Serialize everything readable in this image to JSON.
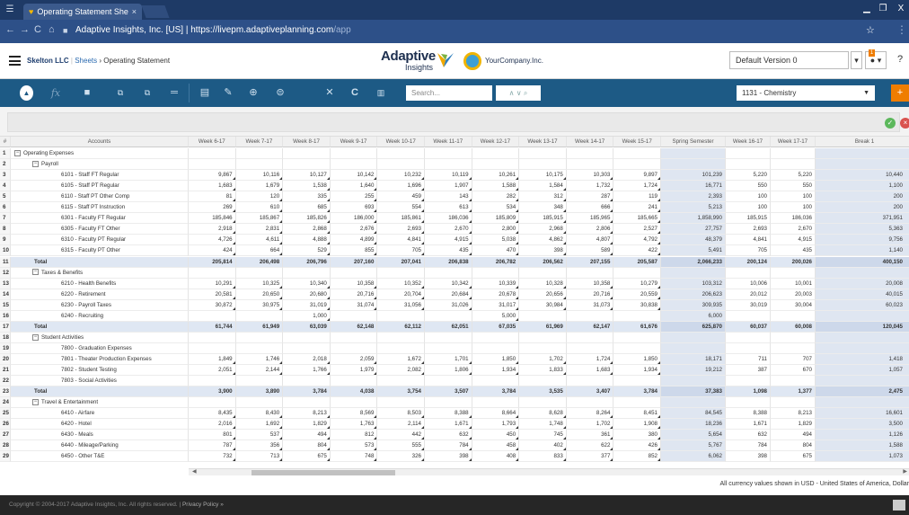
{
  "browser": {
    "tab_title": "Operating Statement She",
    "tab_close": "×",
    "url_host": "Adaptive Insights, Inc. [US]",
    "url_sep": "|",
    "url_main": "https://livepm.adaptiveplanning.com",
    "url_path": "/app",
    "star": "☆",
    "minimize": "▁",
    "maximize": "❐",
    "close": "X"
  },
  "app": {
    "org": "Skelton LLC",
    "sheets": "Sheets",
    "crumb_sep": "›",
    "page": "Operating Statement",
    "brand_top": "Adaptive",
    "brand_bottom": "Insights",
    "company": "YourCompany.Inc.",
    "version": "Default Version 0",
    "notif_count": "1",
    "help": "?"
  },
  "toolbar": {
    "fx": "fx",
    "search_placeholder": "Search...",
    "level": "1131 - Chemistry"
  },
  "grid": {
    "col_hash": "#",
    "col_accounts": "Accounts",
    "week_cols": [
      "Week 6-17",
      "Week 7-17",
      "Week 8-17",
      "Week 9-17",
      "Week 10-17",
      "Week 11-17",
      "Week 12-17",
      "Week 13-17",
      "Week 14-17",
      "Week 15-17"
    ],
    "col_spring": "Spring Semester",
    "col_w16": "Week 16-17",
    "col_w17": "Week 17-17",
    "col_break": "Break 1",
    "rows": [
      {
        "n": "1",
        "label": "Operating Expenses",
        "level": 0,
        "exp": "−",
        "type": "group",
        "v": [
          "",
          "",
          "",
          "",
          "",
          "",
          "",
          "",
          "",
          "",
          "",
          "",
          "",
          ""
        ]
      },
      {
        "n": "2",
        "label": "Payroll",
        "level": 1,
        "exp": "−",
        "type": "group",
        "v": [
          "",
          "",
          "",
          "",
          "",
          "",
          "",
          "",
          "",
          "",
          "",
          "",
          "",
          ""
        ]
      },
      {
        "n": "3",
        "label": "6101 - Staff FT Regular",
        "level": 2,
        "type": "item",
        "v": [
          "9,867",
          "10,116",
          "10,127",
          "10,142",
          "10,232",
          "10,119",
          "10,261",
          "10,175",
          "10,303",
          "9,897",
          "101,239",
          "5,220",
          "5,220",
          "10,440"
        ]
      },
      {
        "n": "4",
        "label": "6105 - Staff PT Regular",
        "level": 2,
        "type": "item",
        "v": [
          "1,683",
          "1,679",
          "1,538",
          "1,640",
          "1,696",
          "1,907",
          "1,588",
          "1,584",
          "1,732",
          "1,724",
          "16,771",
          "550",
          "550",
          "1,100"
        ]
      },
      {
        "n": "5",
        "label": "6110 - Staff PT Other Comp",
        "level": 2,
        "type": "item",
        "v": [
          "81",
          "120",
          "335",
          "255",
          "459",
          "143",
          "282",
          "312",
          "287",
          "119",
          "2,393",
          "100",
          "100",
          "200"
        ]
      },
      {
        "n": "6",
        "label": "6115 - Staff PT Instruction",
        "level": 2,
        "type": "item",
        "v": [
          "269",
          "610",
          "685",
          "693",
          "554",
          "613",
          "534",
          "348",
          "666",
          "241",
          "5,213",
          "100",
          "100",
          "200"
        ]
      },
      {
        "n": "7",
        "label": "6301 - Faculty FT Regular",
        "level": 2,
        "type": "item",
        "v": [
          "185,846",
          "185,867",
          "185,826",
          "186,000",
          "185,861",
          "186,036",
          "185,809",
          "185,915",
          "185,965",
          "185,665",
          "1,858,990",
          "185,915",
          "186,036",
          "371,951"
        ]
      },
      {
        "n": "8",
        "label": "6305 - Faculty FT Other",
        "level": 2,
        "type": "item",
        "v": [
          "2,918",
          "2,831",
          "2,868",
          "2,676",
          "2,693",
          "2,670",
          "2,800",
          "2,968",
          "2,806",
          "2,527",
          "27,757",
          "2,693",
          "2,670",
          "5,363"
        ]
      },
      {
        "n": "9",
        "label": "6310 - Faculty PT Regular",
        "level": 2,
        "type": "item",
        "v": [
          "4,726",
          "4,611",
          "4,888",
          "4,899",
          "4,841",
          "4,915",
          "5,038",
          "4,862",
          "4,807",
          "4,792",
          "48,379",
          "4,841",
          "4,915",
          "9,756"
        ]
      },
      {
        "n": "10",
        "label": "6315 - Faculty PT Other",
        "level": 2,
        "type": "item",
        "v": [
          "424",
          "664",
          "529",
          "855",
          "705",
          "435",
          "470",
          "398",
          "589",
          "422",
          "5,491",
          "705",
          "435",
          "1,140"
        ]
      },
      {
        "n": "11",
        "label": "Total",
        "level": 2,
        "type": "total",
        "v": [
          "205,814",
          "206,498",
          "206,796",
          "207,160",
          "207,041",
          "206,838",
          "206,782",
          "206,562",
          "207,155",
          "205,587",
          "2,066,233",
          "200,124",
          "200,026",
          "400,150"
        ]
      },
      {
        "n": "12",
        "label": "Taxes & Benefits",
        "level": 1,
        "exp": "−",
        "type": "group",
        "v": [
          "",
          "",
          "",
          "",
          "",
          "",
          "",
          "",
          "",
          "",
          "",
          "",
          "",
          ""
        ]
      },
      {
        "n": "13",
        "label": "6210 - Health Benefits",
        "level": 2,
        "type": "item",
        "v": [
          "10,291",
          "10,325",
          "10,340",
          "10,358",
          "10,352",
          "10,342",
          "10,339",
          "10,328",
          "10,358",
          "10,279",
          "103,312",
          "10,006",
          "10,001",
          "20,008"
        ]
      },
      {
        "n": "14",
        "label": "6220 - Retirement",
        "level": 2,
        "type": "item",
        "v": [
          "20,581",
          "20,650",
          "20,680",
          "20,716",
          "20,704",
          "20,684",
          "20,678",
          "20,656",
          "20,716",
          "20,559",
          "206,623",
          "20,012",
          "20,003",
          "40,015"
        ]
      },
      {
        "n": "15",
        "label": "6230 - Payroll Taxes",
        "level": 2,
        "type": "item",
        "v": [
          "30,872",
          "30,975",
          "31,019",
          "31,074",
          "31,056",
          "31,026",
          "31,017",
          "30,984",
          "31,073",
          "30,838",
          "309,935",
          "30,019",
          "30,004",
          "60,023"
        ]
      },
      {
        "n": "16",
        "label": "6240 - Recruiting",
        "level": 2,
        "type": "item",
        "v": [
          "",
          "",
          "1,000",
          "",
          "",
          "",
          "5,000",
          "",
          "",
          "",
          "6,000",
          "",
          "",
          ""
        ]
      },
      {
        "n": "17",
        "label": "Total",
        "level": 2,
        "type": "total",
        "v": [
          "61,744",
          "61,949",
          "63,039",
          "62,148",
          "62,112",
          "62,051",
          "67,035",
          "61,969",
          "62,147",
          "61,676",
          "625,870",
          "60,037",
          "60,008",
          "120,045"
        ]
      },
      {
        "n": "18",
        "label": "Student Activities",
        "level": 1,
        "exp": "−",
        "type": "group",
        "v": [
          "",
          "",
          "",
          "",
          "",
          "",
          "",
          "",
          "",
          "",
          "",
          "",
          "",
          ""
        ]
      },
      {
        "n": "19",
        "label": "7800 - Graduation Expenses",
        "level": 2,
        "type": "item",
        "v": [
          "",
          "",
          "",
          "",
          "",
          "",
          "",
          "",
          "",
          "",
          "",
          "",
          "",
          ""
        ]
      },
      {
        "n": "20",
        "label": "7801 - Theater Production Expenses",
        "level": 2,
        "type": "item",
        "v": [
          "1,849",
          "1,746",
          "2,018",
          "2,059",
          "1,672",
          "1,701",
          "1,850",
          "1,702",
          "1,724",
          "1,850",
          "18,171",
          "711",
          "707",
          "1,418"
        ]
      },
      {
        "n": "21",
        "label": "7802 - Student Testing",
        "level": 2,
        "type": "item",
        "v": [
          "2,051",
          "2,144",
          "1,766",
          "1,979",
          "2,082",
          "1,806",
          "1,934",
          "1,833",
          "1,683",
          "1,934",
          "19,212",
          "387",
          "670",
          "1,057"
        ]
      },
      {
        "n": "22",
        "label": "7803 - Social Activities",
        "level": 2,
        "type": "item",
        "v": [
          "",
          "",
          "",
          "",
          "",
          "",
          "",
          "",
          "",
          "",
          "",
          "",
          "",
          ""
        ]
      },
      {
        "n": "23",
        "label": "Total",
        "level": 2,
        "type": "total",
        "v": [
          "3,900",
          "3,890",
          "3,784",
          "4,038",
          "3,754",
          "3,507",
          "3,784",
          "3,535",
          "3,407",
          "3,784",
          "37,383",
          "1,098",
          "1,377",
          "2,475"
        ]
      },
      {
        "n": "24",
        "label": "Travel & Entertainment",
        "level": 1,
        "exp": "−",
        "type": "group",
        "v": [
          "",
          "",
          "",
          "",
          "",
          "",
          "",
          "",
          "",
          "",
          "",
          "",
          "",
          ""
        ]
      },
      {
        "n": "25",
        "label": "6410 - Airfare",
        "level": 2,
        "type": "item",
        "v": [
          "8,435",
          "8,430",
          "8,213",
          "8,569",
          "8,503",
          "8,388",
          "8,664",
          "8,628",
          "8,264",
          "8,451",
          "84,545",
          "8,388",
          "8,213",
          "16,601"
        ]
      },
      {
        "n": "26",
        "label": "6420 - Hotel",
        "level": 2,
        "type": "item",
        "v": [
          "2,016",
          "1,692",
          "1,829",
          "1,763",
          "2,114",
          "1,671",
          "1,793",
          "1,748",
          "1,702",
          "1,908",
          "18,236",
          "1,671",
          "1,829",
          "3,500"
        ]
      },
      {
        "n": "27",
        "label": "6430 - Meals",
        "level": 2,
        "type": "item",
        "v": [
          "801",
          "537",
          "494",
          "812",
          "442",
          "632",
          "450",
          "745",
          "361",
          "380",
          "5,654",
          "632",
          "494",
          "1,126"
        ]
      },
      {
        "n": "28",
        "label": "6440 - Mileage/Parking",
        "level": 2,
        "type": "item",
        "v": [
          "787",
          "356",
          "804",
          "573",
          "555",
          "784",
          "458",
          "402",
          "622",
          "426",
          "5,767",
          "784",
          "804",
          "1,588"
        ]
      },
      {
        "n": "29",
        "label": "6450 - Other T&E",
        "level": 2,
        "type": "item",
        "v": [
          "732",
          "713",
          "675",
          "748",
          "326",
          "398",
          "408",
          "833",
          "377",
          "852",
          "6,062",
          "398",
          "675",
          "1,073"
        ]
      }
    ]
  },
  "currency_note": "All currency values shown in USD - United States of America, Dollar",
  "footer": {
    "copyright": "Copyright © 2004-2017 Adaptive Insights, Inc. All rights reserved.",
    "sep": "|",
    "privacy": "Privacy Policy »"
  }
}
